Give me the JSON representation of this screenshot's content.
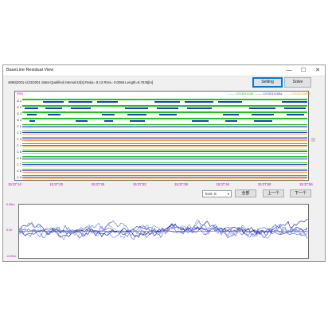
{
  "window": {
    "title": "BaseLine Residual View",
    "minimize": "—",
    "maximize": "☐",
    "close": "✕"
  },
  "info_text": "4860|2001-1/23/2001 State:Qualified Interval:10[s] Ratio= 8.13 Rms= 0.0066 Length=8.7635[m]",
  "buttons": {
    "setting": "Setting",
    "solve": "Solve",
    "all": "全部",
    "prev": "上一个",
    "next": "下一个"
  },
  "selected_baseline": "E10- S",
  "panel_header": "PRN",
  "legend": {
    "a": "—— L2G3D10165",
    "b": "—— L2G3D10165a",
    "c": "—— L2G3D10165b"
  },
  "satellites": [
    "G 1",
    "G 2",
    "G 3",
    "G 4",
    "C 1",
    "C 2",
    "C 3",
    "C 4",
    "C 5",
    "C 6",
    "C 7",
    "C 8",
    "C 9"
  ],
  "time_ticks": [
    "15:37:14",
    "15:37:20",
    "15:37:26",
    "15:37:32",
    "15:37:38",
    "15:37:44",
    "15:37:50",
    "15:37:56"
  ],
  "residual_axis": {
    "top": "0.05m",
    "mid": "0.00",
    "bottom": "-0.05m"
  },
  "colors": {
    "accent": "#0078d7",
    "track_blue": "#1f3ec8",
    "track_green": "#22c022",
    "track_orange": "#ffa040",
    "tick_magenta": "#c000c0"
  }
}
